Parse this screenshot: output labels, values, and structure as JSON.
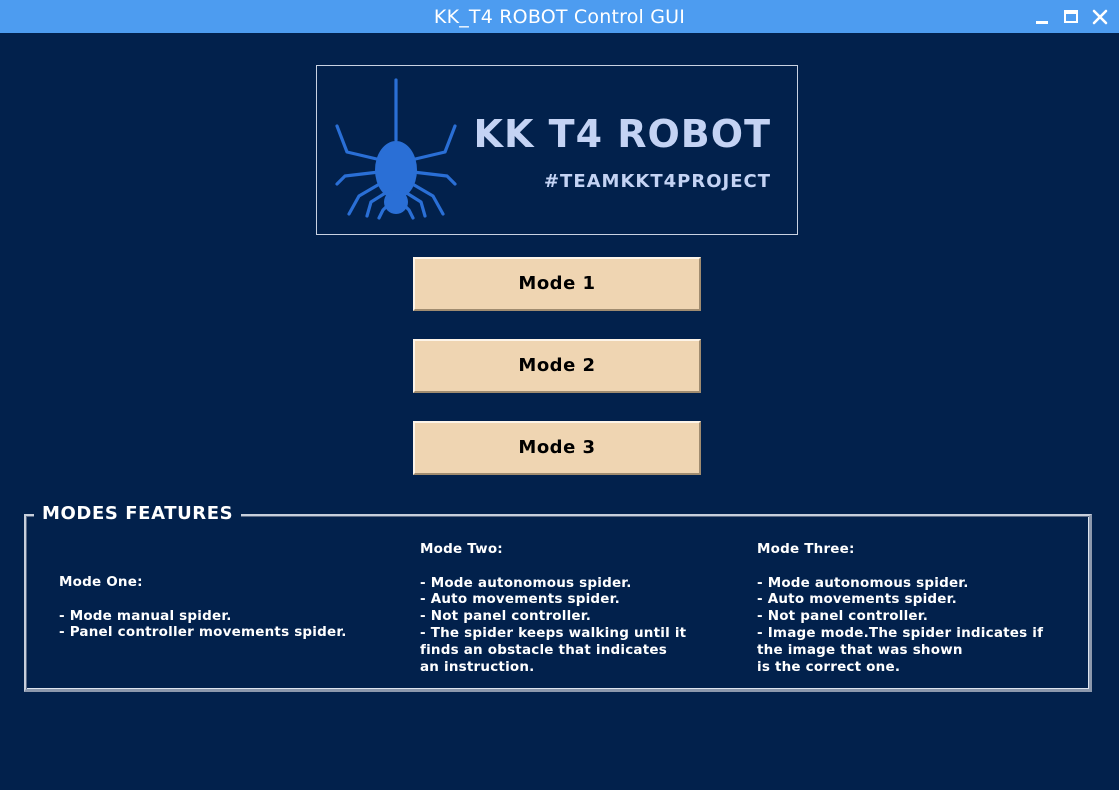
{
  "window": {
    "title": "KK_T4 ROBOT Control GUI"
  },
  "banner": {
    "title": "KK T4 ROBOT",
    "tagline": "#TEAMKKT4PROJECT",
    "logo_icon": "spider-icon",
    "logo_color": "#2a6fd6",
    "text_color": "#c4d3f4"
  },
  "buttons": {
    "mode1": "Mode 1",
    "mode2": "Mode 2",
    "mode3": "Mode 3"
  },
  "features": {
    "legend": "MODES FEATURES",
    "mode_one": {
      "heading": "Mode One:",
      "lines": [
        "- Mode manual spider.",
        "- Panel controller movements spider."
      ]
    },
    "mode_two": {
      "heading": "Mode Two:",
      "lines": [
        "- Mode autonomous spider.",
        "- Auto movements spider.",
        "- Not panel controller.",
        "- The spider keeps walking until it",
        "finds an obstacle that indicates",
        "an instruction."
      ]
    },
    "mode_three": {
      "heading": "Mode Three:",
      "lines": [
        "- Mode autonomous spider.",
        "- Auto movements spider.",
        "- Not panel controller.",
        "- Image mode.The spider indicates if",
        "the image that was shown",
        "is the correct one."
      ]
    }
  },
  "colors": {
    "background": "#02214c",
    "titlebar": "#4d9cf0",
    "button_face": "#efd5b2"
  }
}
